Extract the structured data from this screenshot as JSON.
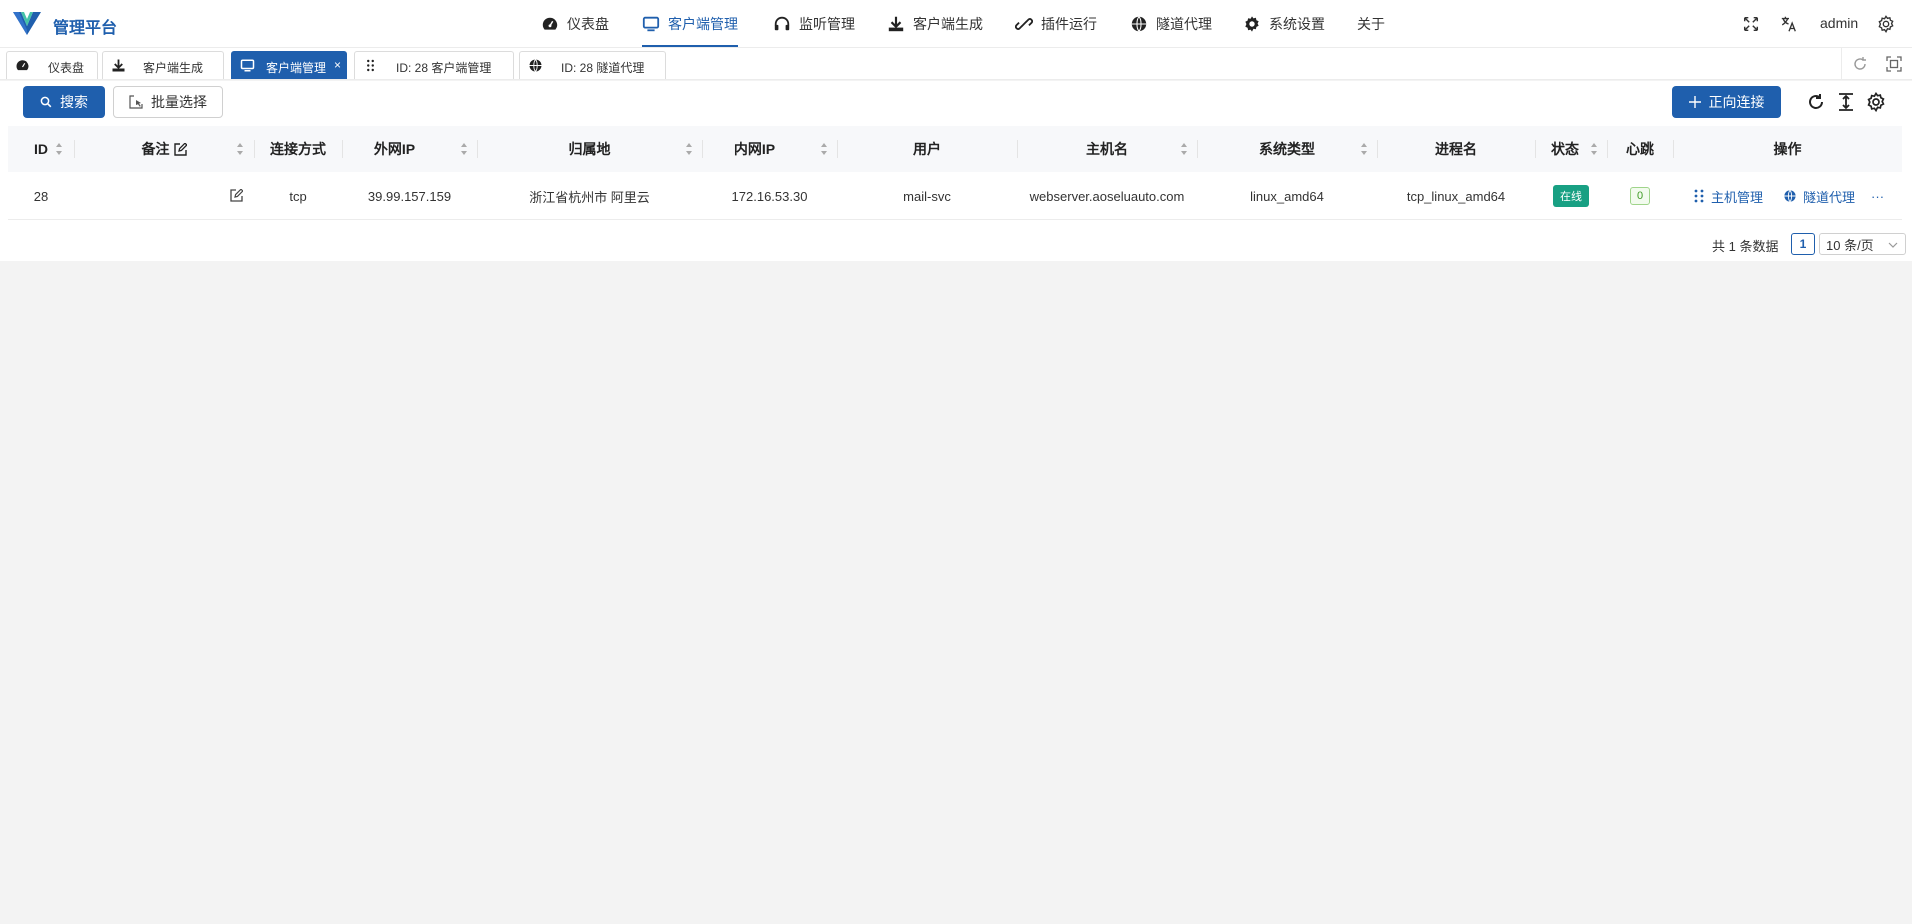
{
  "app": {
    "title": "管理平台"
  },
  "nav": [
    {
      "label": "仪表盘",
      "icon": "dashboard-icon"
    },
    {
      "label": "客户端管理",
      "icon": "monitor-icon",
      "active": true
    },
    {
      "label": "监听管理",
      "icon": "headphones-icon"
    },
    {
      "label": "客户端生成",
      "icon": "download-icon"
    },
    {
      "label": "插件运行",
      "icon": "plugin-icon"
    },
    {
      "label": "隧道代理",
      "icon": "globe-icon"
    },
    {
      "label": "系统设置",
      "icon": "gear-icon"
    },
    {
      "label": "关于"
    }
  ],
  "header_right": {
    "user": "admin",
    "icons": [
      "fullscreen-icon",
      "translate-icon",
      "settings-icon"
    ]
  },
  "tabs": [
    {
      "label": "仪表盘",
      "icon": "dashboard-icon"
    },
    {
      "label": "客户端生成",
      "icon": "download-icon"
    },
    {
      "label": "客户端管理",
      "icon": "monitor-icon",
      "active": true,
      "close": "×"
    },
    {
      "label": "ID: 28 客户端管理",
      "icon": "grid-dots-icon"
    },
    {
      "label": "ID: 28 隧道代理",
      "icon": "globe-icon"
    }
  ],
  "toolbar": {
    "search_label": "搜索",
    "batch_label": "批量选择",
    "connect_label": "正向连接"
  },
  "table": {
    "columns": [
      "ID",
      "备注",
      "连接方式",
      "外网IP",
      "归属地",
      "内网IP",
      "用户",
      "主机名",
      "系统类型",
      "进程名",
      "状态",
      "心跳",
      "操作"
    ],
    "rows": [
      {
        "id": "28",
        "note": "",
        "conn": "tcp",
        "public_ip": "39.99.157.159",
        "location": "浙江省杭州市 阿里云",
        "private_ip": "172.16.53.30",
        "user": "mail-svc",
        "hostname": "webserver.aoseluauto.com",
        "os": "linux_amd64",
        "process": "tcp_linux_amd64",
        "status": "在线",
        "heartbeat": "0",
        "actions": {
          "host": "主机管理",
          "tunnel": "隧道代理",
          "more": "···"
        }
      }
    ]
  },
  "pagination": {
    "total": "共 1 条数据",
    "page": "1",
    "page_size": "10 条/页"
  },
  "colors": {
    "primary": "#1f5fad",
    "online": "#18a083",
    "heartbeat": "#3f9a26",
    "background": "#f3f3f3"
  }
}
